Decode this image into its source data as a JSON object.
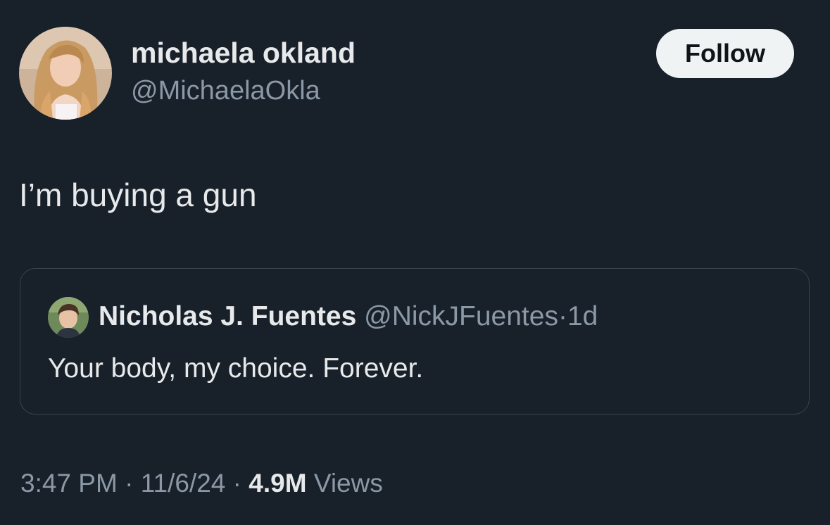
{
  "author": {
    "display_name": "michaela okland",
    "handle": "@MichaelaOkla"
  },
  "follow_button": {
    "label": "Follow"
  },
  "tweet": {
    "text": "I’m buying a gun"
  },
  "quoted_tweet": {
    "display_name": "Nicholas J. Fuentes",
    "handle": "@NickJFuentes",
    "separator": "·",
    "time": "1d",
    "text": "Your body, my choice. Forever."
  },
  "meta": {
    "time": "3:47 PM",
    "separator": "·",
    "date": "11/6/24",
    "views_count": "4.9M",
    "views_label": "Views"
  },
  "colors": {
    "background": "#18202a",
    "primary_text": "#e7e9ea",
    "secondary_text": "#8b98a5",
    "border": "#38444d",
    "follow_button_bg": "#eff3f4"
  }
}
